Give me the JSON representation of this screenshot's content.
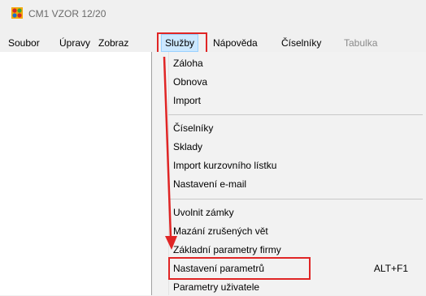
{
  "window": {
    "title": "CM1 VZOR 12/20",
    "icon": "app-logo-icon"
  },
  "menubar": {
    "items": [
      {
        "label": "Soubor"
      },
      {
        "label": "Úpravy"
      },
      {
        "label": "Zobraz"
      },
      {
        "label": "Služby"
      },
      {
        "label": "Nápověda"
      },
      {
        "label": "Číselníky"
      },
      {
        "label": "Tabulka"
      }
    ],
    "active": "Služby",
    "disabled": "Tabulka"
  },
  "dropdown": {
    "items": [
      {
        "label": "Záloha"
      },
      {
        "label": "Obnova"
      },
      {
        "label": "Import"
      },
      {
        "label": "Číselníky"
      },
      {
        "label": "Sklady"
      },
      {
        "label": "Import kurzovního lístku"
      },
      {
        "label": "Nastavení e-mail"
      },
      {
        "label": "Uvolnit zámky"
      },
      {
        "label": "Mazání zrušených vět"
      },
      {
        "label": "Základní parametry firmy"
      },
      {
        "label": "Nastavení parametrů",
        "shortcut": "ALT+F1"
      },
      {
        "label": "Parametry uživatele"
      }
    ]
  },
  "annotation": {
    "color": "#e02525",
    "icon": "arrow-down-icon"
  }
}
